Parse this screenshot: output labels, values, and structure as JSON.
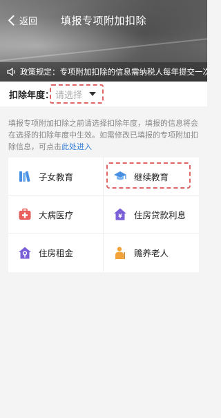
{
  "header": {
    "back_label": "返回",
    "title": "填报专项附加扣除"
  },
  "policy": {
    "text": "政策规定：专项附加扣除的信息需纳税人每年提交一次"
  },
  "year": {
    "label": "扣除年度：",
    "placeholder": "请选择"
  },
  "info": {
    "text": "填报专项附加扣除之前请选择扣除年度，填报的信息将会在选择的扣除年度中生效。如需修改已填报的专项附加扣除信息，可点击",
    "link": "此处进入"
  },
  "categories": [
    {
      "label": "子女教育",
      "icon": "books-icon"
    },
    {
      "label": "继续教育",
      "icon": "graduation-cap-icon"
    },
    {
      "label": "大病医疗",
      "icon": "medical-kit-icon"
    },
    {
      "label": "住房贷款利息",
      "icon": "house-yen-icon"
    },
    {
      "label": "住房租金",
      "icon": "house-key-icon"
    },
    {
      "label": "赡养老人",
      "icon": "elderly-person-icon"
    }
  ],
  "colors": {
    "accent_link": "#2f7bd8",
    "highlight_dash": "#e06666",
    "icon_blue": "#4a90e2",
    "icon_red": "#e85d5d",
    "icon_purple": "#7b5fd6",
    "icon_orange": "#f2a43a"
  }
}
